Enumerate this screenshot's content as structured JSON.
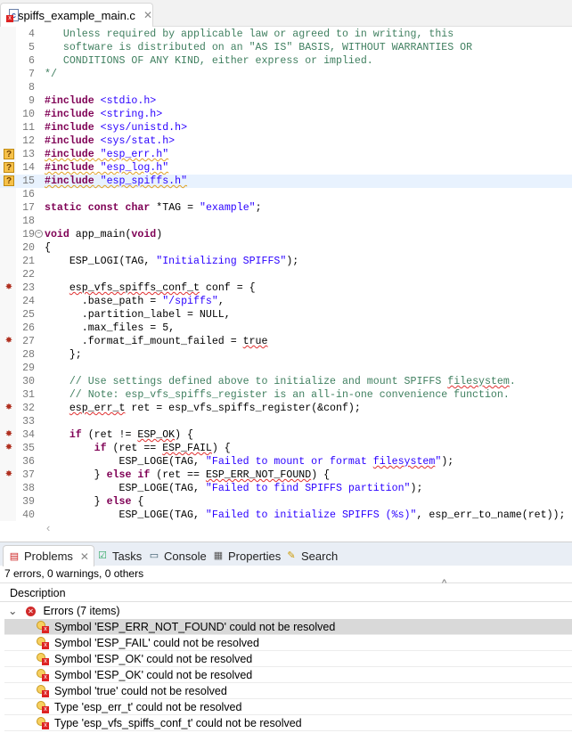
{
  "editor": {
    "tab_title": "spiffs_example_main.c",
    "highlighted_line": 15,
    "lines": [
      {
        "n": 4,
        "t": [
          [
            "cm",
            "   Unless required by applicable law or agreed to in writing, this"
          ]
        ]
      },
      {
        "n": 5,
        "t": [
          [
            "cm",
            "   software is distributed on an \"AS IS\" BASIS, WITHOUT WARRANTIES OR"
          ]
        ]
      },
      {
        "n": 6,
        "t": [
          [
            "cm",
            "   CONDITIONS OF ANY KIND, either express or implied."
          ]
        ]
      },
      {
        "n": 7,
        "t": [
          [
            "cm",
            "*/"
          ]
        ]
      },
      {
        "n": 8,
        "t": []
      },
      {
        "n": 9,
        "t": [
          [
            "kw",
            "#include"
          ],
          [
            "",
            "] "
          ],
          [
            "str",
            "<stdio.h>"
          ]
        ]
      },
      {
        "n": 10,
        "t": [
          [
            "kw",
            "#include"
          ],
          [
            "",
            " "
          ],
          [
            "str",
            "<string.h>"
          ]
        ]
      },
      {
        "n": 11,
        "t": [
          [
            "kw",
            "#include"
          ],
          [
            "",
            " "
          ],
          [
            "str",
            "<sys/unistd.h>"
          ]
        ]
      },
      {
        "n": 12,
        "t": [
          [
            "kw",
            "#include"
          ],
          [
            "",
            " "
          ],
          [
            "str",
            "<sys/stat.h>"
          ]
        ]
      },
      {
        "n": 13,
        "m": "q",
        "t": [
          [
            "kw warn",
            "#include"
          ],
          [
            "warn",
            " "
          ],
          [
            "str warn",
            "\"esp_err.h\""
          ]
        ]
      },
      {
        "n": 14,
        "m": "q",
        "t": [
          [
            "kw warn",
            "#include"
          ],
          [
            "warn",
            " "
          ],
          [
            "str warn",
            "\"esp_log.h\""
          ]
        ]
      },
      {
        "n": 15,
        "m": "q",
        "t": [
          [
            "kw warn",
            "#include"
          ],
          [
            "warn",
            " "
          ],
          [
            "str warn",
            "\"esp_spiffs.h\""
          ]
        ]
      },
      {
        "n": 16,
        "t": []
      },
      {
        "n": 17,
        "t": [
          [
            "kw",
            "static"
          ],
          [
            "",
            " "
          ],
          [
            "kw",
            "const"
          ],
          [
            "",
            " "
          ],
          [
            "kw",
            "char"
          ],
          [
            "",
            " *TAG = "
          ],
          [
            "str",
            "\"example\""
          ],
          [
            "",
            ";"
          ]
        ]
      },
      {
        "n": 18,
        "t": []
      },
      {
        "n": 19,
        "fold": true,
        "t": [
          [
            "kw",
            "void"
          ],
          [
            "",
            " app_main("
          ],
          [
            "kw",
            "void"
          ],
          [
            "",
            ")"
          ]
        ]
      },
      {
        "n": 20,
        "t": [
          [
            "",
            "{"
          ]
        ]
      },
      {
        "n": 21,
        "t": [
          [
            "",
            "    ESP_LOGI(TAG, "
          ],
          [
            "str",
            "\"Initializing SPIFFS\""
          ],
          [
            "",
            ");"
          ]
        ]
      },
      {
        "n": 22,
        "t": []
      },
      {
        "n": 23,
        "m": "bug",
        "t": [
          [
            "",
            "    "
          ],
          [
            "err",
            "esp_vfs_spiffs_conf_t"
          ],
          [
            "",
            " conf = {"
          ]
        ]
      },
      {
        "n": 24,
        "t": [
          [
            "",
            "      .base_path = "
          ],
          [
            "str",
            "\"/spiffs\""
          ],
          [
            "",
            ","
          ]
        ]
      },
      {
        "n": 25,
        "t": [
          [
            "",
            "      .partition_label = NULL,"
          ]
        ]
      },
      {
        "n": 26,
        "t": [
          [
            "",
            "      .max_files = 5,"
          ]
        ]
      },
      {
        "n": 27,
        "m": "bug",
        "t": [
          [
            "",
            "      .format_if_mount_failed = "
          ],
          [
            "err",
            "true"
          ]
        ]
      },
      {
        "n": 28,
        "t": [
          [
            "",
            "    };"
          ]
        ]
      },
      {
        "n": 29,
        "t": []
      },
      {
        "n": 30,
        "t": [
          [
            "cm",
            "    // Use settings defined above to initialize and mount SPIFFS "
          ],
          [
            "cm err",
            "filesystem"
          ],
          [
            "cm",
            "."
          ]
        ]
      },
      {
        "n": 31,
        "t": [
          [
            "cm",
            "    // Note: esp_vfs_spiffs_register is an all-in-one convenience function."
          ]
        ]
      },
      {
        "n": 32,
        "m": "bug",
        "t": [
          [
            "",
            "    "
          ],
          [
            "err",
            "esp_err_t"
          ],
          [
            "",
            " ret = esp_vfs_spiffs_register(&conf);"
          ]
        ]
      },
      {
        "n": 33,
        "t": []
      },
      {
        "n": 34,
        "m": "bug",
        "t": [
          [
            "",
            "    "
          ],
          [
            "kw",
            "if"
          ],
          [
            "",
            " (ret != "
          ],
          [
            "err",
            "ESP_OK"
          ],
          [
            "",
            ") {"
          ]
        ]
      },
      {
        "n": 35,
        "m": "bug",
        "t": [
          [
            "",
            "        "
          ],
          [
            "kw",
            "if"
          ],
          [
            "",
            " (ret == "
          ],
          [
            "err",
            "ESP_FAIL"
          ],
          [
            "",
            ") {"
          ]
        ]
      },
      {
        "n": 36,
        "t": [
          [
            "",
            "            ESP_LOGE(TAG, "
          ],
          [
            "str",
            "\"Failed to mount or format "
          ],
          [
            "str err",
            "filesystem"
          ],
          [
            "str",
            "\""
          ],
          [
            "",
            ");"
          ]
        ]
      },
      {
        "n": 37,
        "m": "bug",
        "t": [
          [
            "",
            "        } "
          ],
          [
            "kw",
            "else"
          ],
          [
            "",
            " "
          ],
          [
            "kw",
            "if"
          ],
          [
            "",
            " (ret == "
          ],
          [
            "err",
            "ESP_ERR_NOT_FOUND"
          ],
          [
            "",
            ") {"
          ]
        ]
      },
      {
        "n": 38,
        "t": [
          [
            "",
            "            ESP_LOGE(TAG, "
          ],
          [
            "str",
            "\"Failed to find SPIFFS partition\""
          ],
          [
            "",
            ");"
          ]
        ]
      },
      {
        "n": 39,
        "t": [
          [
            "",
            "        } "
          ],
          [
            "kw",
            "else"
          ],
          [
            "",
            " {"
          ]
        ]
      },
      {
        "n": 40,
        "t": [
          [
            "",
            "            ESP_LOGE(TAG, "
          ],
          [
            "str",
            "\"Failed to initialize SPIFFS (%s)\""
          ],
          [
            "",
            ", esp_err_to_name(ret));"
          ]
        ]
      }
    ]
  },
  "panel": {
    "tabs": [
      {
        "label": "Problems",
        "icon": "problems-icon",
        "active": true
      },
      {
        "label": "Tasks",
        "icon": "tasks-icon"
      },
      {
        "label": "Console",
        "icon": "console-icon"
      },
      {
        "label": "Properties",
        "icon": "properties-icon"
      },
      {
        "label": "Search",
        "icon": "search-icon"
      }
    ],
    "summary": "7 errors, 0 warnings, 0 others",
    "column_header": "Description",
    "group_label": "Errors (7 items)",
    "items": [
      "Symbol 'ESP_ERR_NOT_FOUND' could not be resolved",
      "Symbol 'ESP_FAIL' could not be resolved",
      "Symbol 'ESP_OK' could not be resolved",
      "Symbol 'ESP_OK' could not be resolved",
      "Symbol 'true' could not be resolved",
      "Type 'esp_err_t' could not be resolved",
      "Type 'esp_vfs_spiffs_conf_t' could not be resolved"
    ],
    "selected_index": 0
  }
}
